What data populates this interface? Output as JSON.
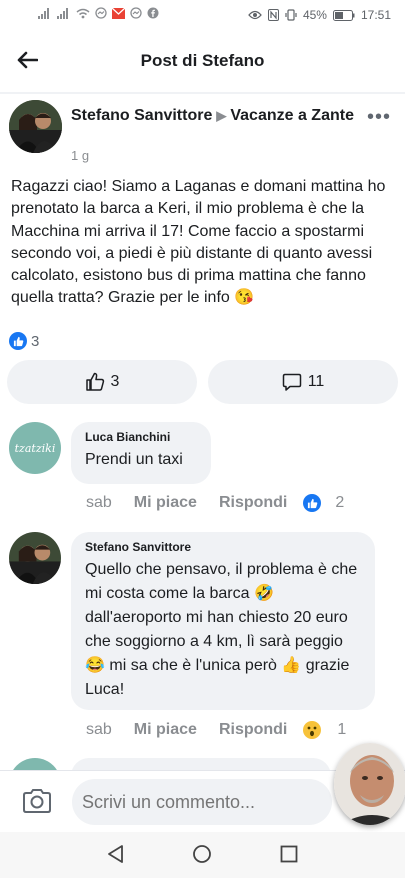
{
  "status_bar": {
    "battery": "45%",
    "time": "17:51"
  },
  "app_bar": {
    "title": "Post di Stefano"
  },
  "post": {
    "author": "Stefano Sanvittore",
    "group": "Vacanze a Zante",
    "time": "1 g",
    "text": "Ragazzi ciao! Siamo a Laganas e domani mattina ho prenotato la barca a Keri, il mio problema è che la Macchina mi arriva il 17! Come faccio a spostarmi secondo voi, a piedi è più distante di quanto avessi calcolato, esistono bus di prima mattina che fanno quella tratta? Grazie per le info 😘",
    "reactions": "3",
    "like_count": "3",
    "comment_count": "11"
  },
  "comments": [
    {
      "author": "Luca Bianchini",
      "text": "Prendi un taxi",
      "time": "sab",
      "like_label": "Mi piace",
      "reply_label": "Rispondi",
      "reactions": "2"
    },
    {
      "author": "Stefano Sanvittore",
      "text": "Quello che pensavo, il problema è che mi costa come la barca 🤣 dall'aeroporto mi han chiesto 20 euro che soggiorno a 4 km, lì sarà peggio 😂 mi sa che è l'unica però 👍 grazie Luca!",
      "time": "sab",
      "like_label": "Mi piace",
      "reply_label": "Rispondi",
      "reactions": "1"
    }
  ],
  "avatar_text": "tzatziki",
  "composer": {
    "placeholder": "Scrivi un commento..."
  },
  "colors": {
    "accent": "#1877f2",
    "bubble": "#f0f2f5",
    "meta_text": "#8a8d91"
  }
}
